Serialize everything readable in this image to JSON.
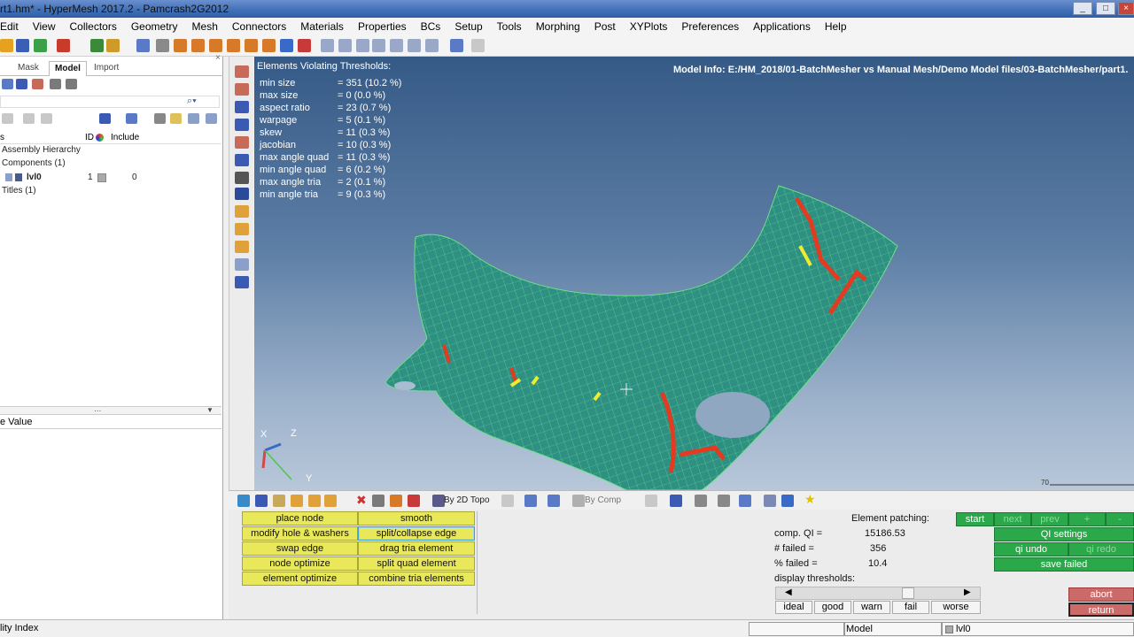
{
  "window": {
    "title": "rt1.hm* - HyperMesh 2017.2 - Pamcrash2G2012"
  },
  "menu": [
    "Edit",
    "View",
    "Collectors",
    "Geometry",
    "Mesh",
    "Connectors",
    "Materials",
    "Properties",
    "BCs",
    "Setup",
    "Tools",
    "Morphing",
    "Post",
    "XYPlots",
    "Preferences",
    "Applications",
    "Help"
  ],
  "browser": {
    "tabs": [
      "Mask",
      "Model",
      "Import"
    ],
    "columns": {
      "id": "ID",
      "include": "Include"
    },
    "tree": {
      "assembly": "Assembly Hierarchy",
      "components": "Components (1)",
      "component": {
        "name": "lvl0",
        "id": "1",
        "include": "0"
      },
      "titles": "Titles (1)"
    },
    "value_header": "e Value",
    "splitter_dots": "..."
  },
  "viewport": {
    "violations_title": "Elements Violating Thresholds:",
    "model_info": "Model Info: E:/HM_2018/01-BatchMesher vs Manual Mesh/Demo Model files/03-BatchMesher/part1.",
    "stats": [
      {
        "label": "min size",
        "value": "= 351 (10.2 %)"
      },
      {
        "label": "max size",
        "value": "= 0    (0.0 %)"
      },
      {
        "label": "aspect ratio",
        "value": "= 23   (0.7 %)"
      },
      {
        "label": "warpage",
        "value": "= 5    (0.1 %)"
      },
      {
        "label": "skew",
        "value": "= 11   (0.3 %)"
      },
      {
        "label": "jacobian",
        "value": "= 10   (0.3 %)"
      },
      {
        "label": "max angle quad",
        "value": "= 11   (0.3 %)"
      },
      {
        "label": "min angle quad",
        "value": "= 6    (0.2 %)"
      },
      {
        "label": "max angle tria",
        "value": "= 2    (0.1 %)"
      },
      {
        "label": "min angle tria",
        "value": "= 9    (0.3 %)"
      }
    ],
    "axes": {
      "x": "X",
      "y": "Y",
      "z": "Z"
    },
    "scale": "70"
  },
  "lower_toolbar": {
    "topo": "By 2D Topo",
    "comp": "By Comp"
  },
  "panel": {
    "buttons": [
      [
        "place node",
        "smooth"
      ],
      [
        "modify hole & washers",
        "split/collapse edge"
      ],
      [
        "swap edge",
        "drag tria element"
      ],
      [
        "node optimize",
        "split quad element"
      ],
      [
        "element optimize",
        "combine tria elements"
      ]
    ],
    "patching": {
      "title": "Element patching:",
      "rows": [
        {
          "label": "comp. QI =",
          "value": "15186.53"
        },
        {
          "label": "# failed =",
          "value": "356"
        },
        {
          "label": "% failed =",
          "value": "10.4"
        }
      ],
      "thresholds_label": "display thresholds:",
      "thresholds": [
        "ideal",
        "good",
        "warn",
        "fail",
        "worse"
      ]
    },
    "nav": [
      "start",
      "next",
      "prev",
      "+",
      "-"
    ],
    "qi": {
      "settings": "QI settings",
      "undo": "qi undo",
      "redo": "qi redo",
      "save_failed": "save failed"
    },
    "abort": "abort",
    "return": "return"
  },
  "status": {
    "left": "lity Index",
    "model": "Model",
    "comp": "lvl0"
  },
  "colors": {
    "mesh": "#2e8f83",
    "mesh_edge": "#6fe08a",
    "fail": "#e43a20",
    "warn": "#ecec30",
    "panel_yellow": "#e8e85a",
    "panel_green": "#2aa84a",
    "panel_red": "#cc6a6a"
  }
}
